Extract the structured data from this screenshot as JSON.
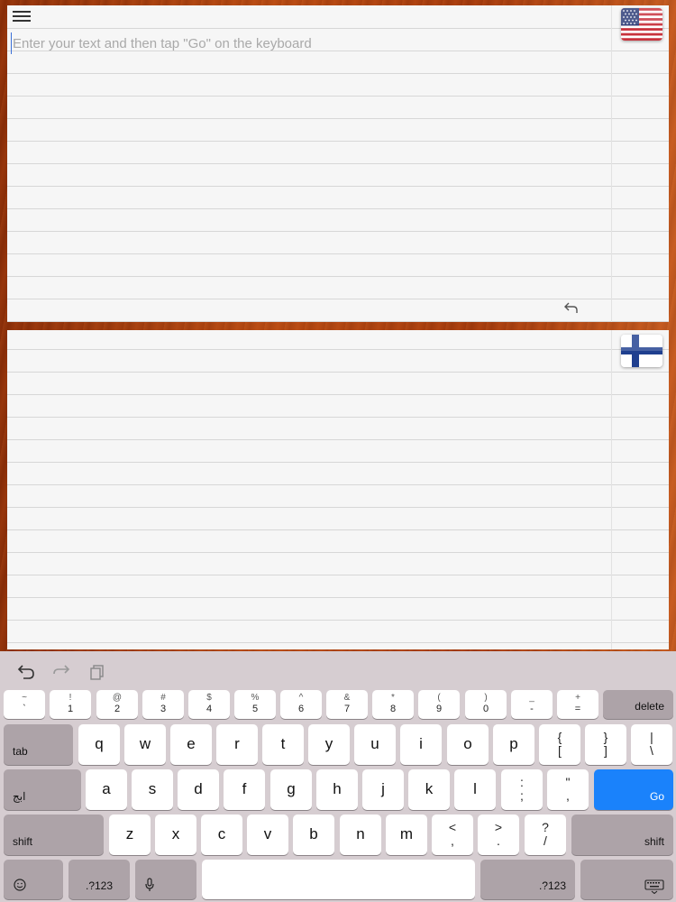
{
  "source_panel": {
    "placeholder": "Enter your text and then tap \"Go\" on the keyboard",
    "flag": "us-flag-icon"
  },
  "target_panel": {
    "flag": "finland-flag-icon"
  },
  "keyboard": {
    "toolbar": [
      "undo-icon",
      "redo-icon",
      "paste-icon"
    ],
    "number_row": [
      {
        "top": "~",
        "bottom": "`"
      },
      {
        "top": "!",
        "bottom": "1"
      },
      {
        "top": "@",
        "bottom": "2"
      },
      {
        "top": "#",
        "bottom": "3"
      },
      {
        "top": "$",
        "bottom": "4"
      },
      {
        "top": "%",
        "bottom": "5"
      },
      {
        "top": "^",
        "bottom": "6"
      },
      {
        "top": "&",
        "bottom": "7"
      },
      {
        "top": "*",
        "bottom": "8"
      },
      {
        "top": "(",
        "bottom": "9"
      },
      {
        "top": ")",
        "bottom": "0"
      },
      {
        "top": "_",
        "bottom": "-"
      },
      {
        "top": "+",
        "bottom": "="
      }
    ],
    "delete_label": "delete",
    "tab_label": "tab",
    "row1": [
      "q",
      "w",
      "e",
      "r",
      "t",
      "y",
      "u",
      "i",
      "o",
      "p"
    ],
    "row1_pairs": [
      {
        "top": "{",
        "bottom": "["
      },
      {
        "top": "}",
        "bottom": "]"
      },
      {
        "top": "|",
        "bottom": "\\"
      }
    ],
    "lang_label": "ابج",
    "row2": [
      "a",
      "s",
      "d",
      "f",
      "g",
      "h",
      "j",
      "k",
      "l"
    ],
    "row2_pairs": [
      {
        "top": ":",
        "bottom": ";"
      },
      {
        "top": "\"",
        "bottom": ","
      }
    ],
    "go_label": "Go",
    "shift_label": "shift",
    "row3": [
      "z",
      "x",
      "c",
      "v",
      "b",
      "n",
      "m"
    ],
    "row3_pairs": [
      {
        "top": "<",
        "bottom": ","
      },
      {
        "top": ">",
        "bottom": "."
      },
      {
        "top": "?",
        "bottom": "/"
      }
    ],
    "numbers_label": ".?123",
    "colors": {
      "go": "#1a82fb",
      "keyboard_bg": "#d6cdd1"
    }
  }
}
